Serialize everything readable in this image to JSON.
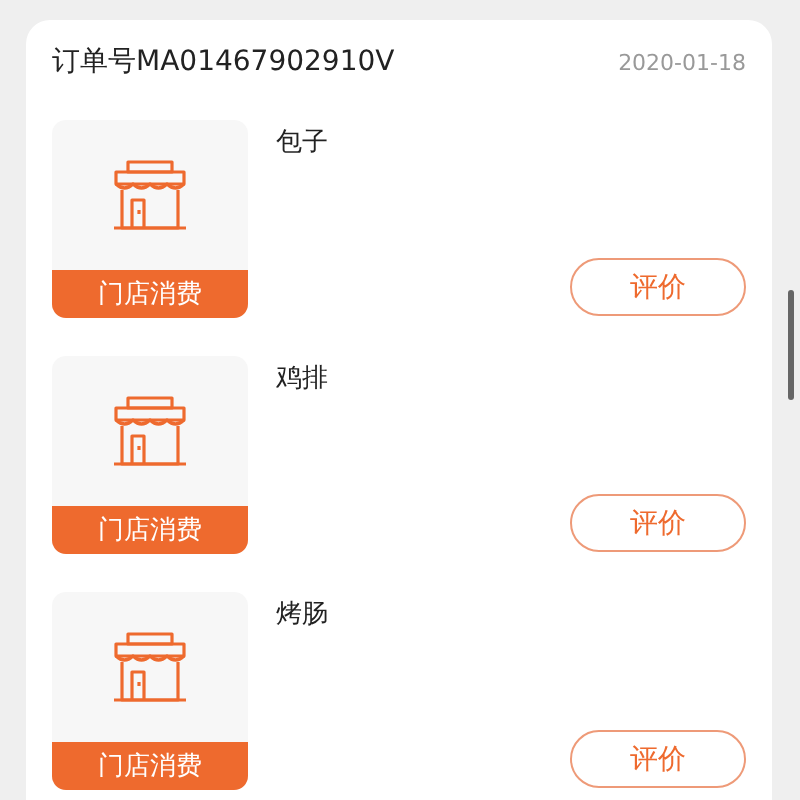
{
  "order": {
    "number": "订单号MA01467902910V",
    "date": "2020-01-18"
  },
  "items": [
    {
      "name": "包子",
      "tag": "门店消费",
      "button": "评价"
    },
    {
      "name": "鸡排",
      "tag": "门店消费",
      "button": "评价"
    },
    {
      "name": "烤肠",
      "tag": "门店消费",
      "button": "评价"
    }
  ]
}
